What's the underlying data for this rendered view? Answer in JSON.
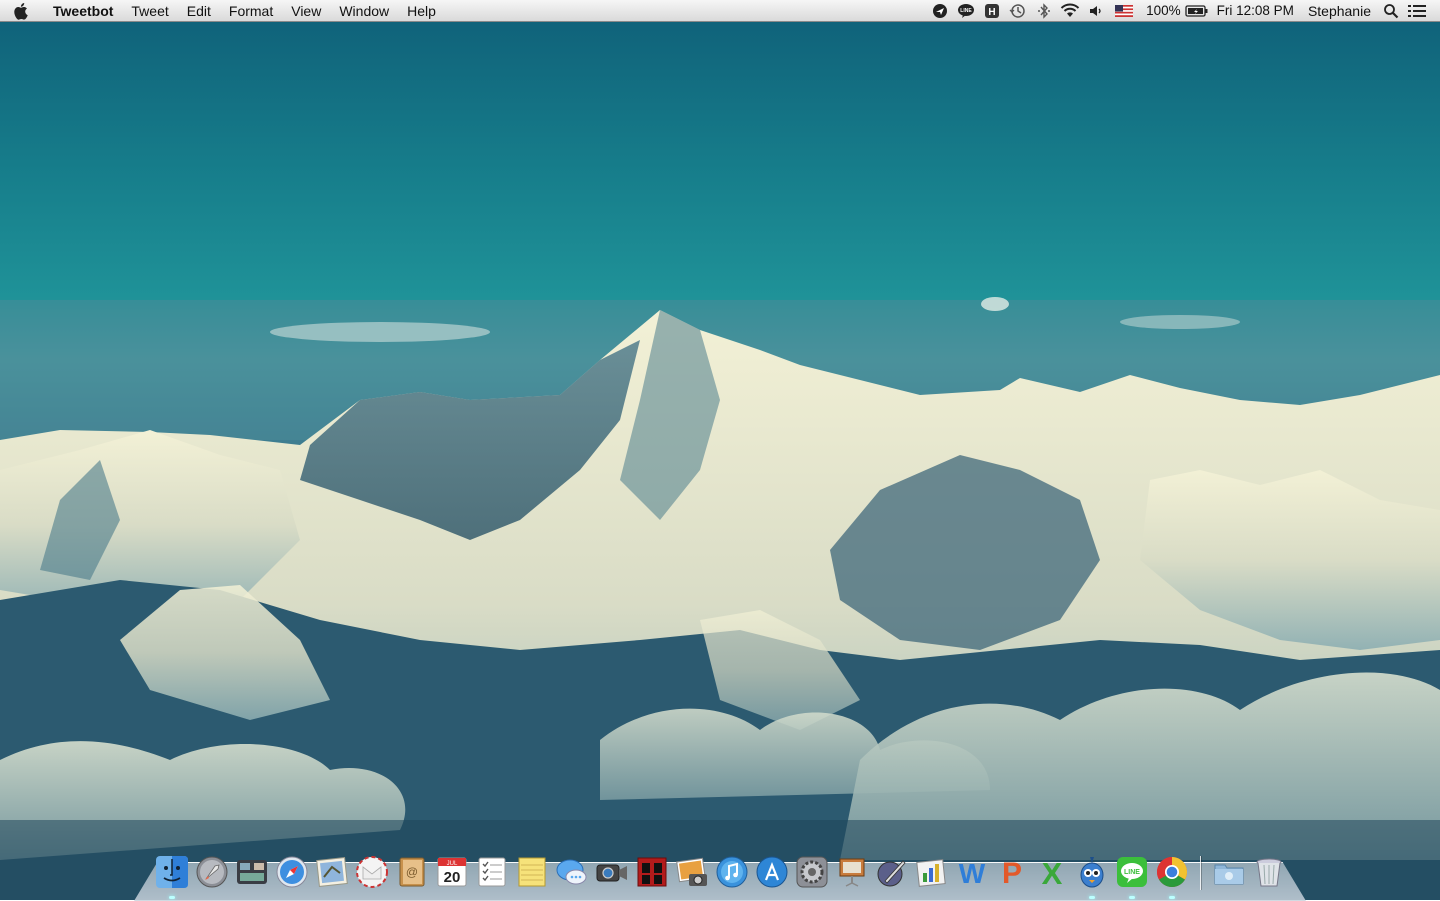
{
  "menubar": {
    "app_name": "Tweetbot",
    "menus": [
      "Tweet",
      "Edit",
      "Format",
      "View",
      "Window",
      "Help"
    ],
    "battery": "100%",
    "clock": "Fri 12:08 PM",
    "user": "Stephanie",
    "status_icons": [
      "airmail-icon",
      "line-status-icon",
      "h-status-icon",
      "time-machine-icon",
      "bluetooth-icon",
      "wifi-icon",
      "volume-icon",
      "us-flag-icon",
      "battery-icon",
      "spotlight-icon",
      "notification-center-icon"
    ]
  },
  "calendar_icon": {
    "month": "JUL",
    "day": "20"
  },
  "dock": {
    "apps": [
      "finder",
      "launchpad",
      "mission-control",
      "safari",
      "mail",
      "calendar-alt",
      "contacts",
      "calendar",
      "reminders",
      "notes",
      "messages",
      "facetime",
      "photo-booth",
      "iphoto",
      "itunes",
      "app-store",
      "system-preferences",
      "keynote",
      "pen-app",
      "numbers",
      "word",
      "powerpoint",
      "excel",
      "tweetbot",
      "line",
      "chrome"
    ],
    "right": [
      "downloads-folder",
      "trash"
    ]
  },
  "colors": {
    "sky": "#177f8c",
    "menubar": "#e8e8e8"
  }
}
